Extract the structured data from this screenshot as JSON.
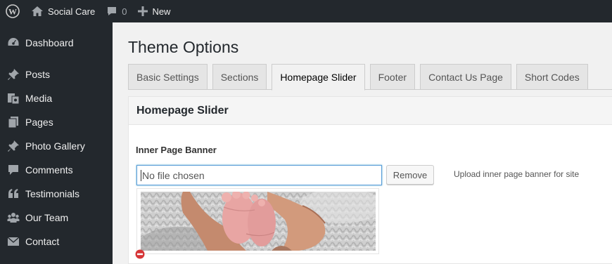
{
  "adminbar": {
    "site_name": "Social Care",
    "comments_count": "0",
    "new_label": "New",
    "icons": {
      "logo": "wordpress-icon",
      "home": "home-icon",
      "comments": "comment-icon",
      "new": "plus-icon"
    }
  },
  "sidebar": {
    "items": [
      {
        "label": "Dashboard",
        "icon": "dashboard-icon"
      },
      {
        "label": "Posts",
        "icon": "pin-icon"
      },
      {
        "label": "Media",
        "icon": "media-icon"
      },
      {
        "label": "Pages",
        "icon": "pages-icon"
      },
      {
        "label": "Photo Gallery",
        "icon": "pin-icon"
      },
      {
        "label": "Comments",
        "icon": "comment-icon"
      },
      {
        "label": "Testimonials",
        "icon": "quote-icon"
      },
      {
        "label": "Our Team",
        "icon": "team-icon"
      },
      {
        "label": "Contact",
        "icon": "mail-icon"
      }
    ]
  },
  "page": {
    "title": "Theme Options",
    "tabs": [
      {
        "label": "Basic Settings",
        "active": false
      },
      {
        "label": "Sections",
        "active": false
      },
      {
        "label": "Homepage Slider",
        "active": true
      },
      {
        "label": "Footer",
        "active": false
      },
      {
        "label": "Contact Us Page",
        "active": false
      },
      {
        "label": "Short Codes",
        "active": false
      }
    ],
    "panel": {
      "heading": "Homepage Slider",
      "field_label": "Inner Page Banner",
      "file_value": "No file chosen",
      "remove_label": "Remove",
      "help_text": "Upload inner page banner for site"
    }
  },
  "colors": {
    "adminbar_bg": "#23282d",
    "focus_border": "#5b9dd9",
    "remove_icon": "#d63638"
  }
}
